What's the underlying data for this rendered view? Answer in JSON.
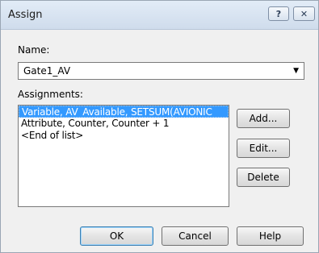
{
  "window": {
    "title": "Assign",
    "help_glyph": "?",
    "close_glyph": "✕"
  },
  "name_field": {
    "label": "Name:",
    "value": "Gate1_AV"
  },
  "assignments": {
    "label": "Assignments:",
    "items": [
      "Variable, AV_Available, SETSUM(AVIONIC",
      "Attribute, Counter, Counter + 1",
      "<End of list>"
    ],
    "selected_index": 0
  },
  "side_buttons": {
    "add": "Add...",
    "edit": "Edit...",
    "delete": "Delete"
  },
  "bottom_buttons": {
    "ok": "OK",
    "cancel": "Cancel",
    "help": "Help"
  },
  "colors": {
    "selection": "#3399ff",
    "dialog_bg": "#f0f0f0",
    "titlebar": "#dde8f5"
  },
  "icons": {
    "combo_arrow": "chevron-down-icon",
    "help": "question-icon",
    "close": "close-icon"
  }
}
